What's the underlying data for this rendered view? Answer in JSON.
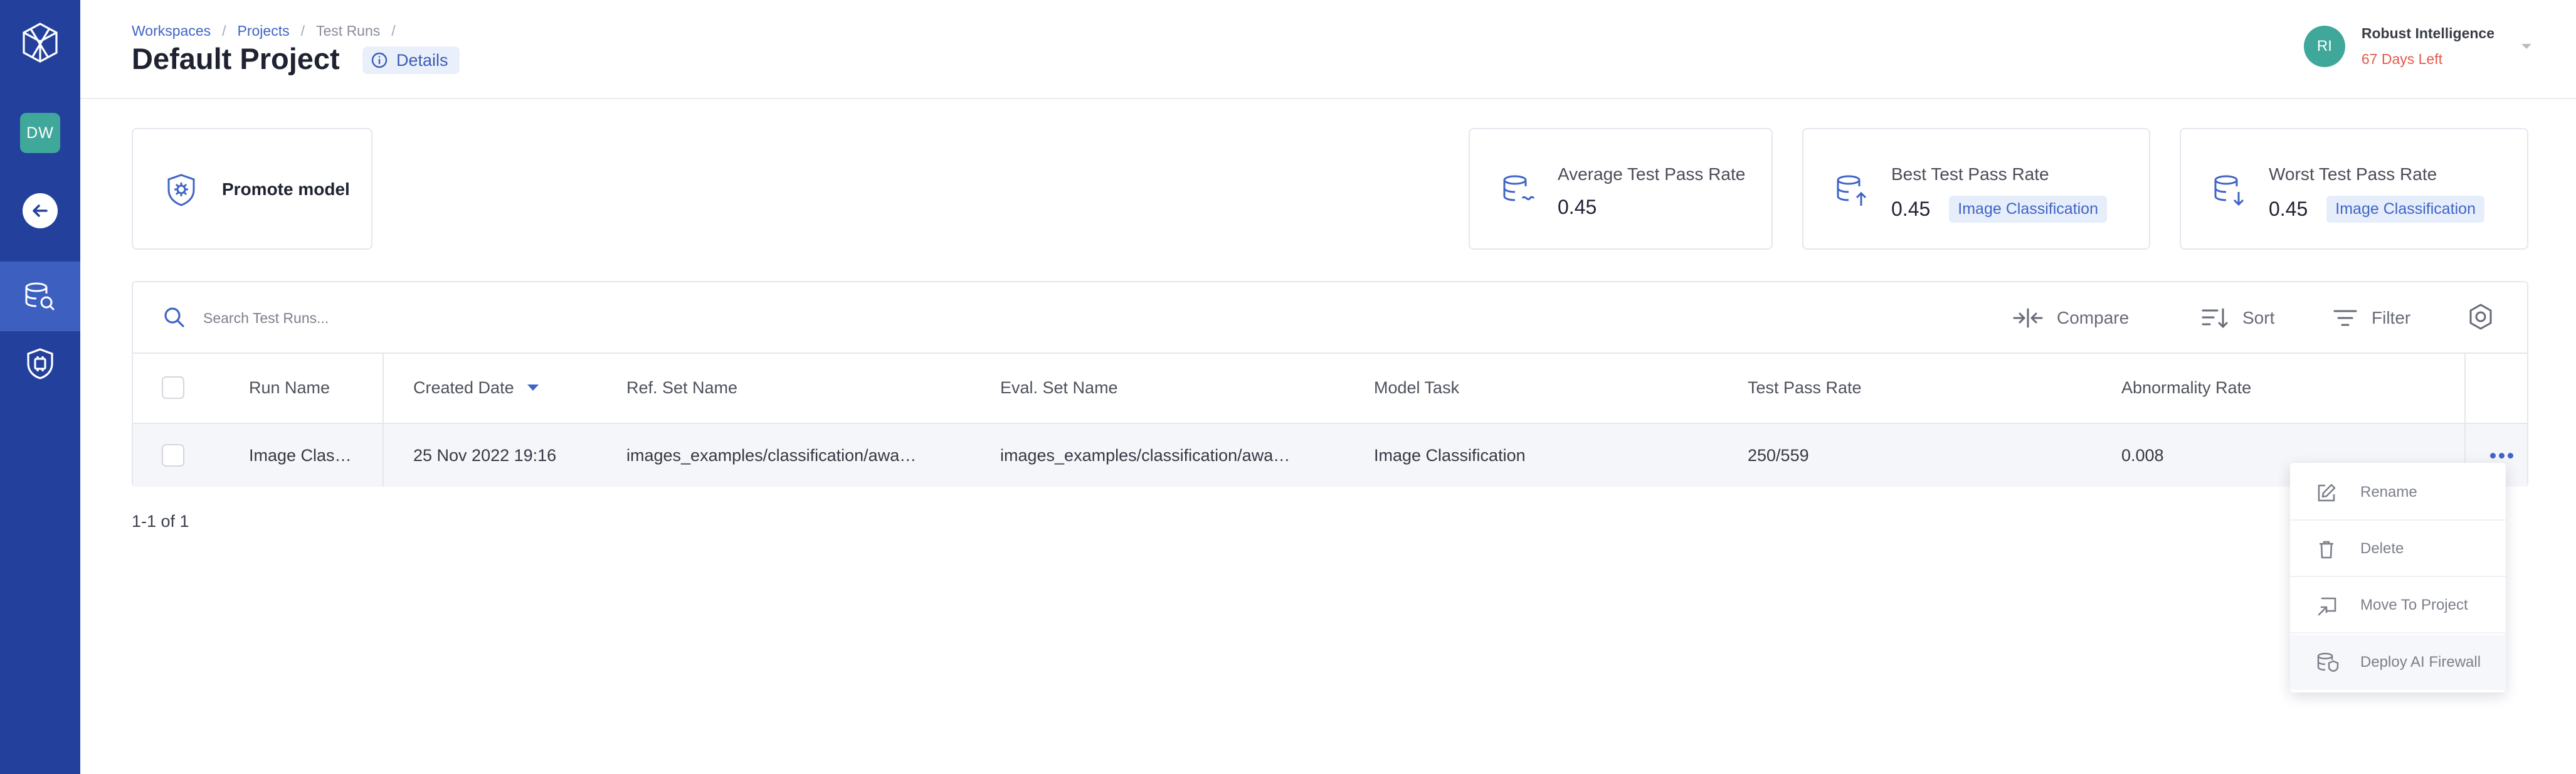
{
  "header": {
    "breadcrumb": [
      "Workspaces",
      "Projects",
      "Test Runs"
    ],
    "breadcrumb_sep": "/",
    "title": "Default Project",
    "details_label": "Details"
  },
  "user": {
    "initials": "RI",
    "name": "Robust Intelligence",
    "trial": "67 Days Left"
  },
  "sidebar": {
    "workspace_badge": "DW"
  },
  "cards": {
    "promote_label": "Promote model",
    "avg": {
      "label": "Average Test Pass Rate",
      "value": "0.45"
    },
    "best": {
      "label": "Best Test Pass Rate",
      "value": "0.45",
      "chip": "Image Classification"
    },
    "worst": {
      "label": "Worst Test Pass Rate",
      "value": "0.45",
      "chip": "Image Classification"
    }
  },
  "toolbar": {
    "search_placeholder": "Search Test Runs...",
    "compare": "Compare",
    "sort": "Sort",
    "filter": "Filter"
  },
  "table": {
    "columns": [
      "Run Name",
      "Created Date",
      "Ref. Set Name",
      "Eval. Set Name",
      "Model Task",
      "Test Pass Rate",
      "Abnormality Rate"
    ],
    "rows": [
      [
        "Image Clas…",
        "25 Nov 2022 19:16",
        "images_examples/classification/awa…",
        "images_examples/classification/awa…",
        "Image Classification",
        "250/559",
        "0.008"
      ]
    ]
  },
  "pager": "1-1 of 1",
  "menu": {
    "items": [
      "Rename",
      "Delete",
      "Move To Project",
      "Deploy AI Firewall"
    ]
  },
  "colors": {
    "rail": "#23419c",
    "rail_active": "#3c5fc0",
    "accent": "#3f64c6",
    "teal": "#40a89a",
    "warning": "#e4594c"
  }
}
